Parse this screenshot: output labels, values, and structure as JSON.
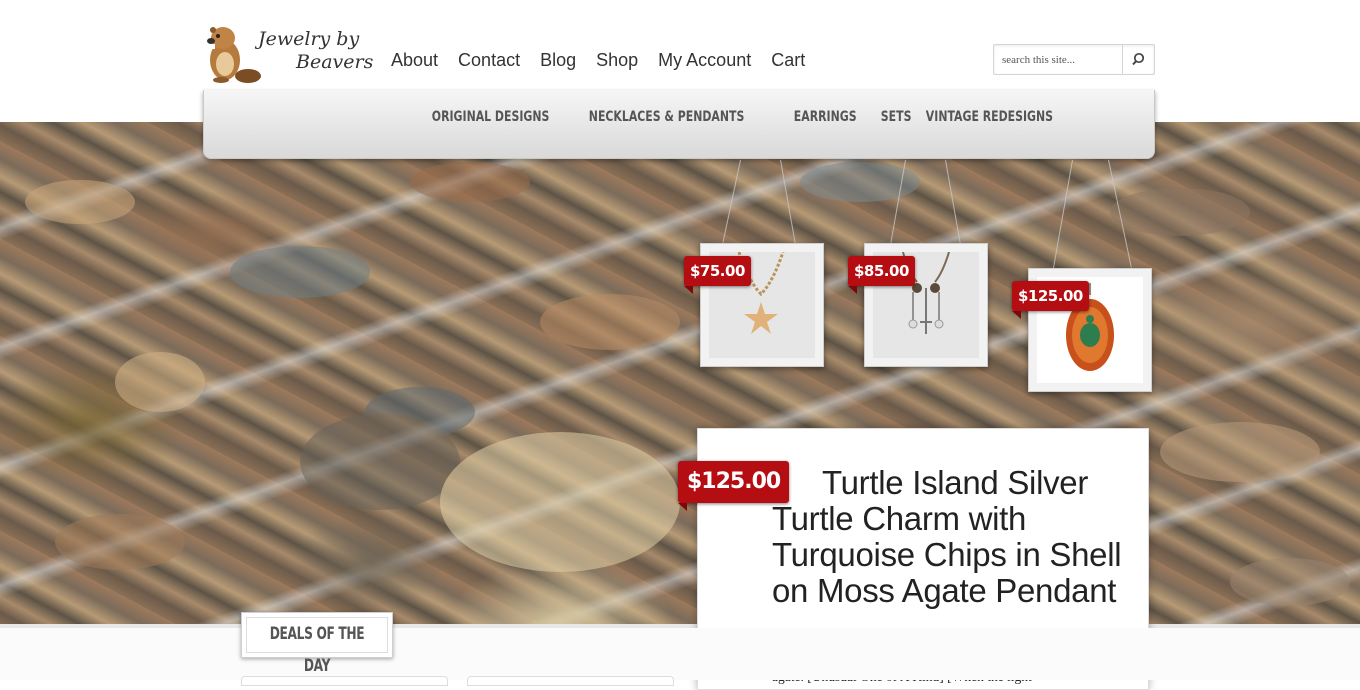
{
  "brand": {
    "name_line1": "Jewelry by",
    "name_line2": "Beavers"
  },
  "nav": [
    "About",
    "Contact",
    "Blog",
    "Shop",
    "My Account",
    "Cart"
  ],
  "search": {
    "placeholder": "search this site..."
  },
  "categories": [
    "ORIGINAL DESIGNS",
    "NECKLACES & PENDANTS",
    "EARRINGS",
    "SETS",
    "VINTAGE REDESIGNS"
  ],
  "hanging_products": [
    {
      "price": "$75.00"
    },
    {
      "price": "$85.00"
    },
    {
      "price": "$125.00"
    }
  ],
  "featured": {
    "price": "$125.00",
    "title": "Turtle Island Silver Turtle Charm with Turquoise Chips in Shell on Moss Agate Pendant",
    "description": "Silver turtle charm with turquoise chips in shell on moss agate. [Unusual One of A Kind] [When the light"
  },
  "deals": {
    "label": "DEALS OF THE DAY"
  },
  "colors": {
    "price_tag": "#b40d12",
    "nav_text": "#333333",
    "category_text": "#555555"
  }
}
